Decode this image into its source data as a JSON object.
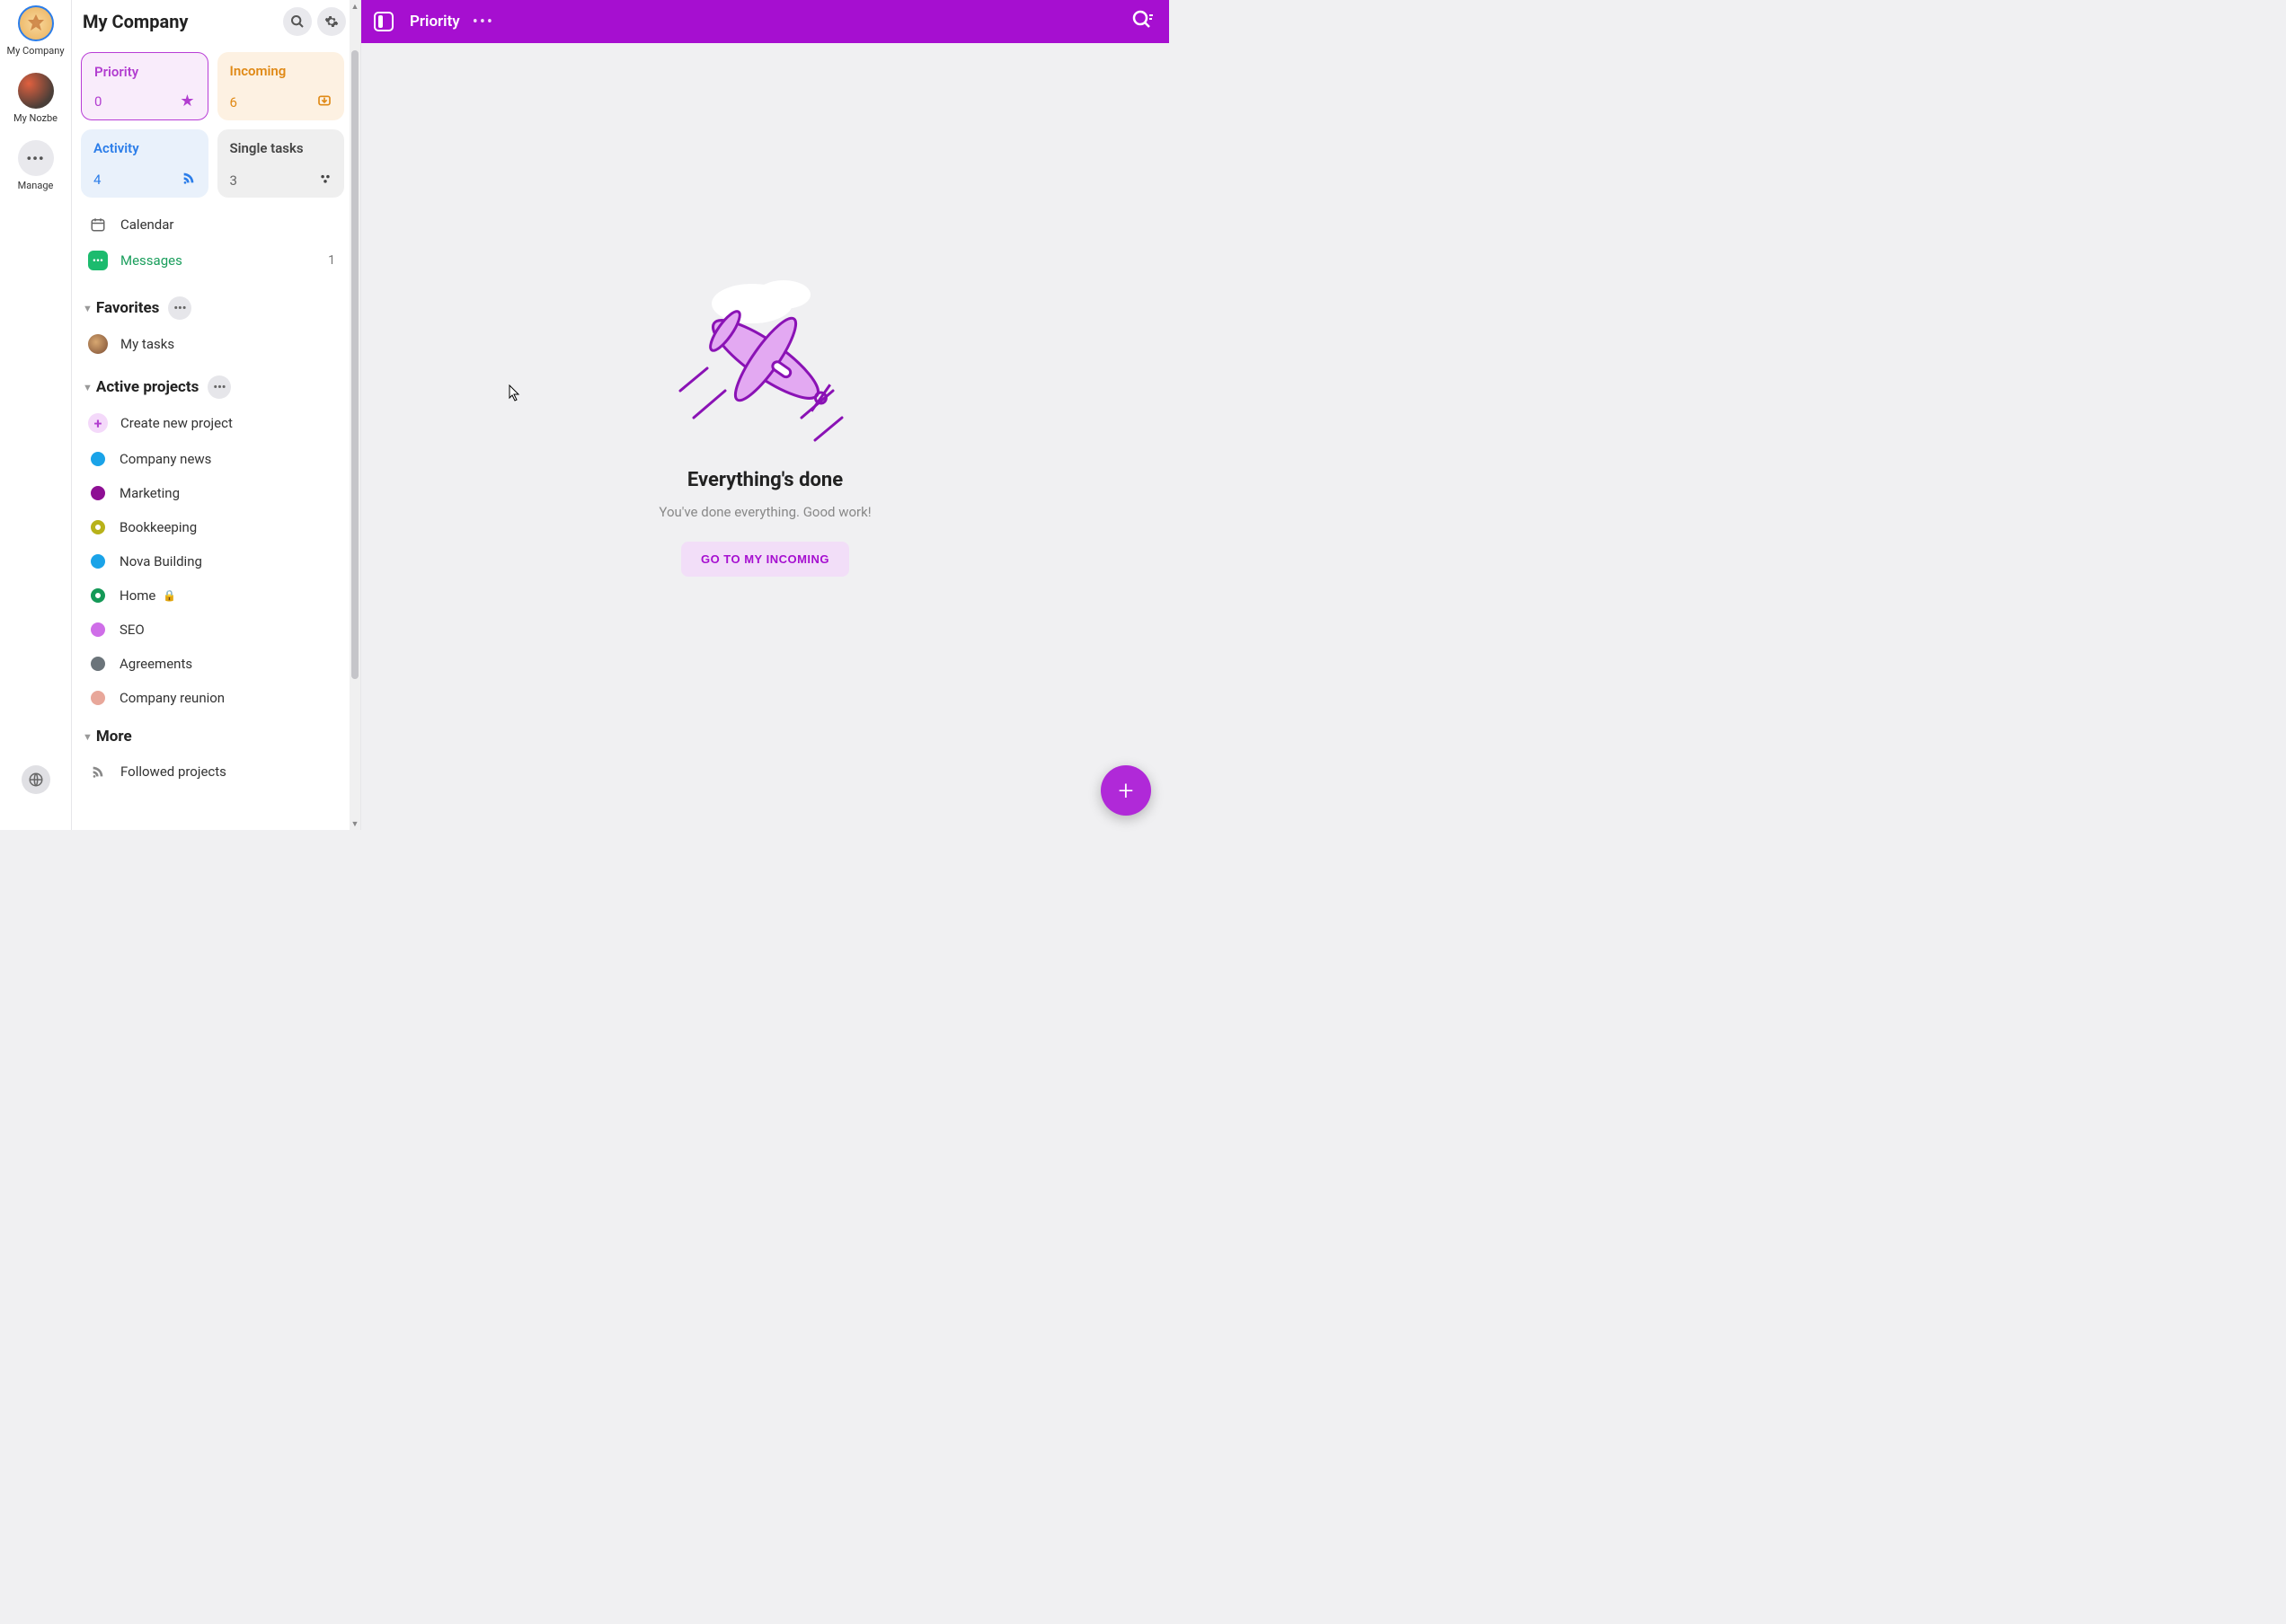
{
  "rail": {
    "workspaces": [
      {
        "id": "company",
        "label": "My Company"
      },
      {
        "id": "nozbe",
        "label": "My Nozbe"
      },
      {
        "id": "manage",
        "label": "Manage",
        "glyph": "•••"
      }
    ]
  },
  "sidebar": {
    "title": "My Company",
    "tiles": {
      "priority": {
        "title": "Priority",
        "count": "0"
      },
      "incoming": {
        "title": "Incoming",
        "count": "6"
      },
      "activity": {
        "title": "Activity",
        "count": "4"
      },
      "single": {
        "title": "Single tasks",
        "count": "3"
      }
    },
    "calendar_label": "Calendar",
    "messages_label": "Messages",
    "messages_count": "1",
    "favorites_header": "Favorites",
    "favorites": [
      {
        "label": "My tasks"
      }
    ],
    "active_projects_header": "Active projects",
    "create_project_label": "Create new project",
    "projects": [
      {
        "label": "Company news",
        "color": "#1aa3e8"
      },
      {
        "label": "Marketing",
        "color": "#8e0f94"
      },
      {
        "label": "Bookkeeping",
        "color": "#b8b21a"
      },
      {
        "label": "Nova Building",
        "color": "#1aa3e8"
      },
      {
        "label": "Home",
        "color": "#149957",
        "locked": true
      },
      {
        "label": "SEO",
        "color": "#cf6ee8"
      },
      {
        "label": "Agreements",
        "color": "#6b747a"
      },
      {
        "label": "Company reunion",
        "color": "#e8a79a"
      }
    ],
    "more_header": "More",
    "followed_projects_label": "Followed projects"
  },
  "main": {
    "title": "Priority",
    "empty_title": "Everything's done",
    "empty_sub": "You've done everything. Good work!",
    "cta": "GO TO MY INCOMING"
  },
  "colors": {
    "brand": "#a60fd0"
  }
}
